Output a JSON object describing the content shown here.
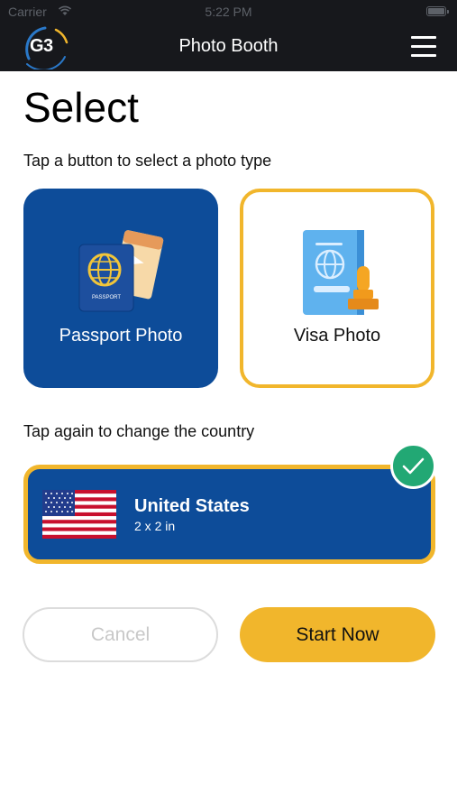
{
  "status_bar": {
    "carrier": "Carrier",
    "time": "5:22 PM"
  },
  "header": {
    "logo_text": "G3",
    "title": "Photo Booth"
  },
  "page": {
    "title": "Select",
    "type_prompt": "Tap a button to select a photo type",
    "country_prompt": "Tap again to change the country"
  },
  "photo_types": [
    {
      "label": "Passport Photo",
      "icon": "passport-icon",
      "selected": true
    },
    {
      "label": "Visa Photo",
      "icon": "visa-stamp-icon",
      "selected": false
    }
  ],
  "passport_icon_text": "PASSPORT",
  "country": {
    "name": "United States",
    "size": "2 x 2 in",
    "flag": "us-flag-icon"
  },
  "buttons": {
    "cancel": "Cancel",
    "start": "Start Now"
  },
  "colors": {
    "header_bg": "#17181c",
    "primary_blue": "#0d4c99",
    "accent_yellow": "#f1b62c",
    "check_green": "#22a874"
  }
}
